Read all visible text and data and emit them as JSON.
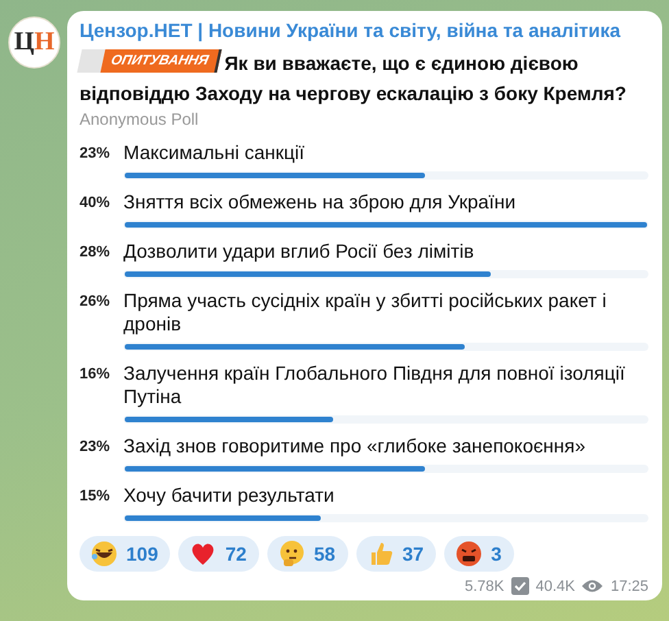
{
  "channel": {
    "name": "Цензор.НЕТ | Новини України та світу, війна та аналітика",
    "avatar_letters": [
      "Ц",
      "Н"
    ]
  },
  "post": {
    "badge": "ОПИТУВАННЯ",
    "question": "Як ви вважаєте, що є єдиною дієвою відповіддю Заходу на чергову ескалацію з боку Кремля?",
    "poll_type": "Anonymous Poll"
  },
  "options": [
    {
      "percent": "23%",
      "text": "Максимальні санкції",
      "level": 0.575
    },
    {
      "percent": "40%",
      "text": "Зняття всіх обмежень на зброю для України",
      "level": 1.0
    },
    {
      "percent": "28%",
      "text": "Дозволити удари вглиб Росії без лімітів",
      "level": 0.7
    },
    {
      "percent": "26%",
      "text": "Пряма участь сусідніх країн у збитті російських ракет і дронів",
      "level": 0.65
    },
    {
      "percent": "16%",
      "text": "Залучення країн Глобального Півдня для повної ізоляції Путіна",
      "level": 0.4
    },
    {
      "percent": "23%",
      "text": "Захід знов говоритиме про «глибоке занепокоєння»",
      "level": 0.575
    },
    {
      "percent": "15%",
      "text": "Хочу бачити результати",
      "level": 0.375
    }
  ],
  "reactions": [
    {
      "kind": "laughing",
      "count": "109"
    },
    {
      "kind": "heart",
      "count": "72"
    },
    {
      "kind": "thinking",
      "count": "58"
    },
    {
      "kind": "thumbs_up",
      "count": "37"
    },
    {
      "kind": "angry",
      "count": "3"
    }
  ],
  "footer": {
    "shares": "5.78K",
    "views": "40.4K",
    "time": "17:25"
  }
}
